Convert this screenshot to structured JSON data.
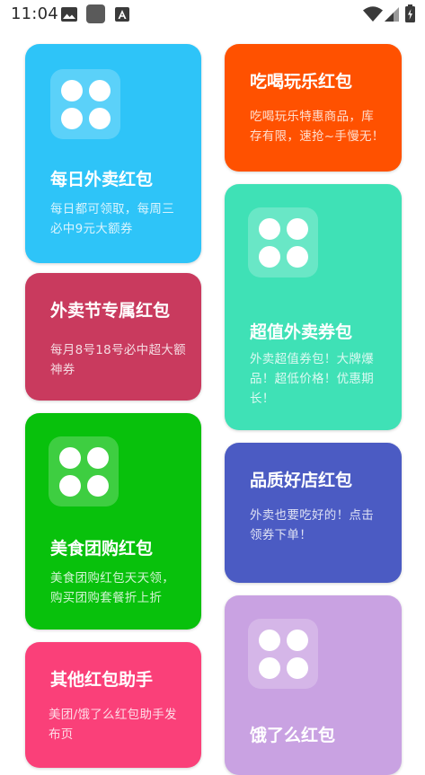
{
  "status_bar": {
    "time": "11:04",
    "icons": [
      "image-icon",
      "app-square-icon",
      "a-badge-icon",
      "wifi-icon",
      "cell-signal-icon",
      "battery-icon"
    ]
  },
  "cards": [
    {
      "title": "每日外卖红包",
      "desc_lines": [
        "每日都可领取，每周三",
        "必中9元大额券"
      ],
      "color": "#2EC4F8",
      "icon": "four-dots-icon"
    },
    {
      "title": "外卖节专属红包",
      "desc_lines": [
        "每月8号18号必中超大额",
        "神券"
      ],
      "color": "#C93A5E"
    },
    {
      "title": "美食团购红包",
      "desc_lines": [
        "美食团购红包天天领，",
        "购买团购套餐折上折"
      ],
      "color": "#08C10C",
      "icon": "four-dots-icon"
    },
    {
      "title": "其他红包助手",
      "desc_lines": [
        "美团/饿了么红包助手发",
        "布页"
      ],
      "color": "#FA4079"
    },
    {
      "title": "吃喝玩乐红包",
      "desc_lines": [
        "吃喝玩乐特惠商品，库",
        "存有限，速抢~手慢无！"
      ],
      "color": "#FF5100"
    },
    {
      "title": "超值外卖券包",
      "desc_lines": [
        "外卖超值券包！大牌爆",
        "品！超低价格！优惠期",
        "长！"
      ],
      "color": "#3FE1B6",
      "icon": "four-dots-icon"
    },
    {
      "title": "品质好店红包",
      "desc_lines": [
        "外卖也要吃好的！点击",
        "领券下单！"
      ],
      "color": "#4B5BC3"
    },
    {
      "title": "饿了么红包",
      "desc_lines": [],
      "color": "#C9A2E2",
      "icon": "four-dots-icon"
    }
  ]
}
